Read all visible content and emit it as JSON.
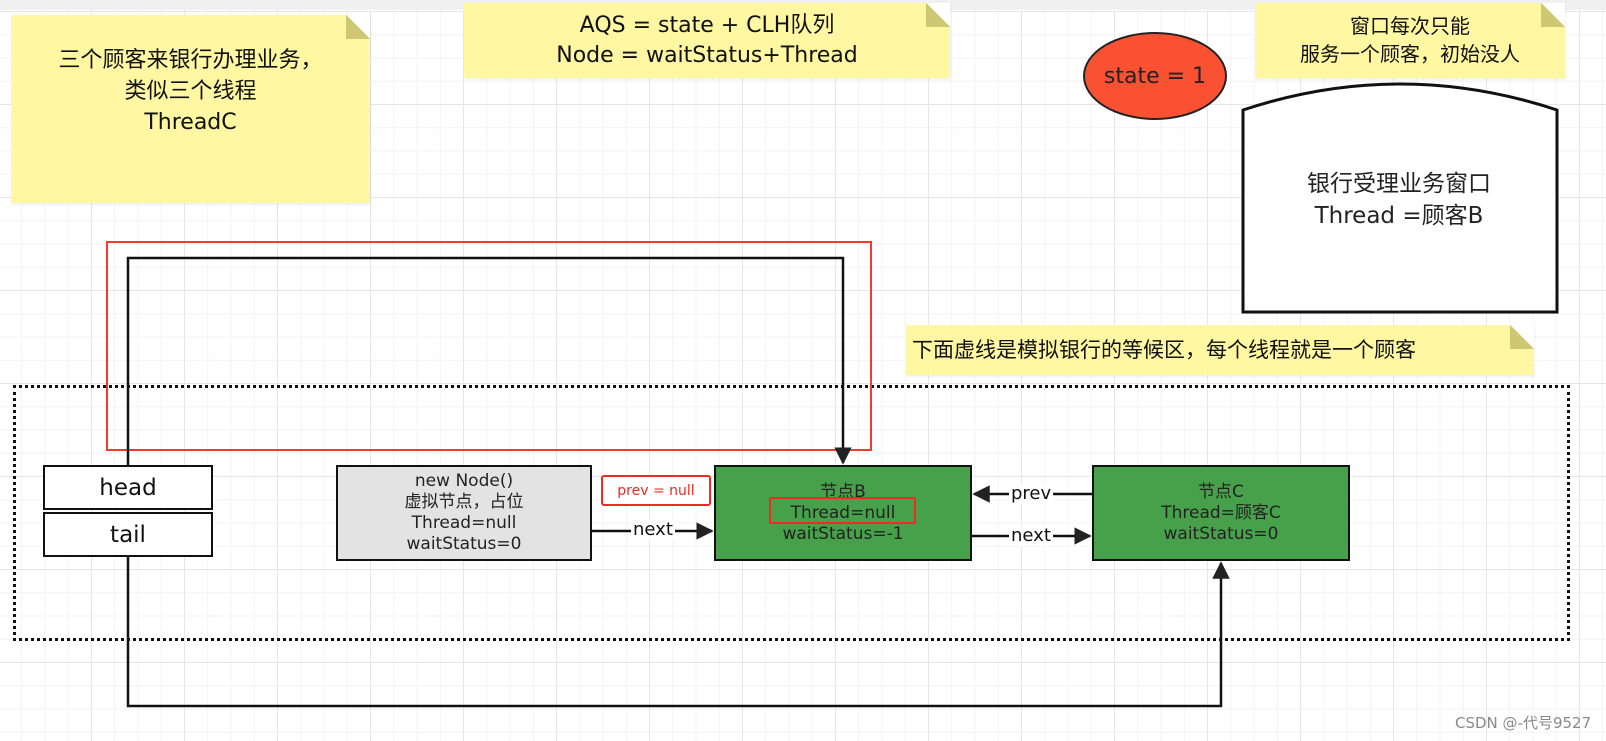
{
  "notes": {
    "threads": {
      "lines": [
        "三个顾客来银行办理业务，",
        "类似三个线程",
        "ThreadC"
      ]
    },
    "aqs": {
      "lines": [
        "AQS = state + CLH队列",
        "Node = waitStatus+Thread"
      ]
    },
    "window_rule": {
      "lines": [
        "窗口每次只能",
        "服务一个顾客，初始没人"
      ]
    },
    "waiting_area": {
      "text": "下面虚线是模拟银行的等候区，每个线程就是一个顾客"
    }
  },
  "state": {
    "label": "state = 1",
    "color": "#fa5133"
  },
  "bank_window": {
    "lines": [
      "银行受理业务窗口",
      "Thread =顾客B"
    ]
  },
  "pointers": {
    "head": "head",
    "tail": "tail"
  },
  "nodes": {
    "dummy": {
      "lines": [
        "new Node()",
        "虚拟节点，占位",
        "Thread=null",
        "waitStatus=0"
      ],
      "color": "#e3e3e3"
    },
    "b": {
      "lines": [
        "节点B",
        "Thread=null",
        "waitStatus=-1"
      ],
      "color": "#47a14b"
    },
    "c": {
      "lines": [
        "节点C",
        "Thread=顾客C",
        "waitStatus=0"
      ],
      "color": "#47a14b"
    }
  },
  "annotations": {
    "prev_null": "prev = null",
    "highlight_color": "#ee2a24"
  },
  "edges": {
    "dummy_to_b": "next",
    "c_to_b": "prev",
    "b_to_c": "next"
  },
  "watermark": "CSDN @-代号9527"
}
